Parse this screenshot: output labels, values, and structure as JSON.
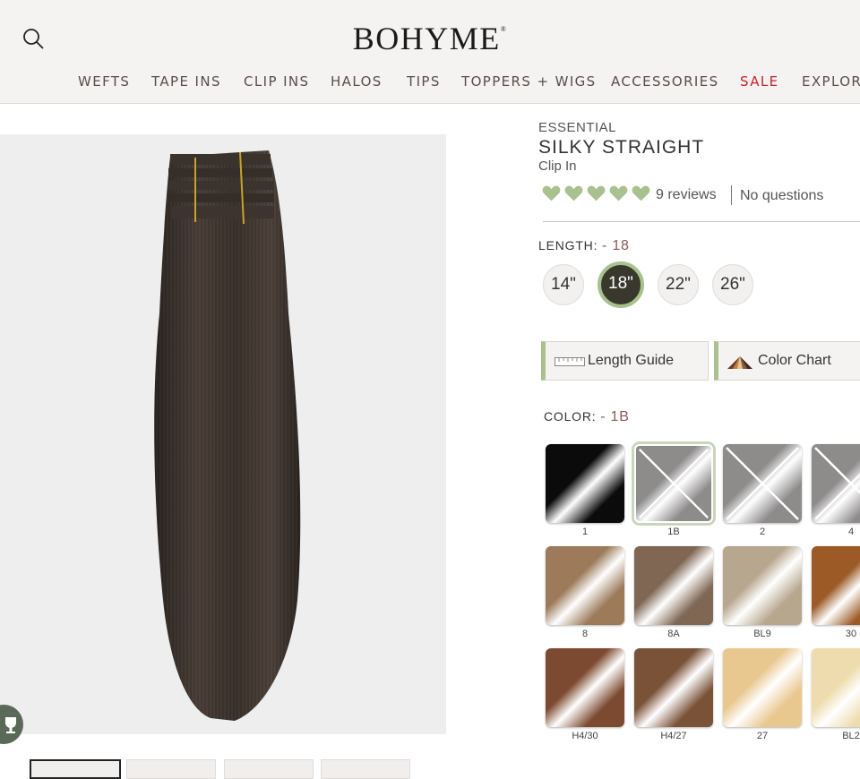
{
  "header": {
    "logo": "BOHYME",
    "logo_mark": "®",
    "nav": [
      "WEFTS",
      "TAPE INS",
      "CLIP INS",
      "HALOS",
      "TIPS",
      "TOPPERS + WIGS",
      "ACCESSORIES",
      "SALE",
      "EXPLORE"
    ]
  },
  "product": {
    "brand": "ESSENTIAL",
    "title": "SILKY STRAIGHT",
    "subtitle": "Clip In",
    "rating": 5,
    "reviews": "9 reviews",
    "questions": "No questions"
  },
  "length": {
    "label": "LENGTH:",
    "value": "- 18",
    "options": [
      "14\"",
      "18\"",
      "22\"",
      "26\""
    ],
    "selected": "18\""
  },
  "buttons": {
    "length_guide": "Length Guide",
    "color_chart": "Color Chart"
  },
  "color": {
    "label": "COLOR:",
    "value": "- 1B",
    "swatches": [
      {
        "label": "1",
        "color": "#0b0b0b",
        "unavailable": false
      },
      {
        "label": "1B",
        "color": "#8e8b8b",
        "unavailable": true
      },
      {
        "label": "2",
        "color": "#8e8b8b",
        "unavailable": true
      },
      {
        "label": "4",
        "color": "#8e8b8b",
        "unavailable": true
      },
      {
        "label": "8",
        "color": "#9c7a5a",
        "unavailable": false
      },
      {
        "label": "8A",
        "color": "#7f6754",
        "unavailable": false
      },
      {
        "label": "BL9",
        "color": "#b8a78f",
        "unavailable": false
      },
      {
        "label": "30",
        "color": "#9b5a26",
        "unavailable": false
      },
      {
        "label": "H4/30",
        "color": "#7c4a30",
        "unavailable": false
      },
      {
        "label": "H4/27",
        "color": "#7a5238",
        "unavailable": false
      },
      {
        "label": "27",
        "color": "#e9c88f",
        "unavailable": false
      },
      {
        "label": "BL2",
        "color": "#eedcae",
        "unavailable": false
      }
    ]
  },
  "colors": {
    "accent_green": "#a9c18f",
    "sale_red": "#c8232c",
    "value_brown": "#8a5a56",
    "selected_dark": "#39382c"
  }
}
